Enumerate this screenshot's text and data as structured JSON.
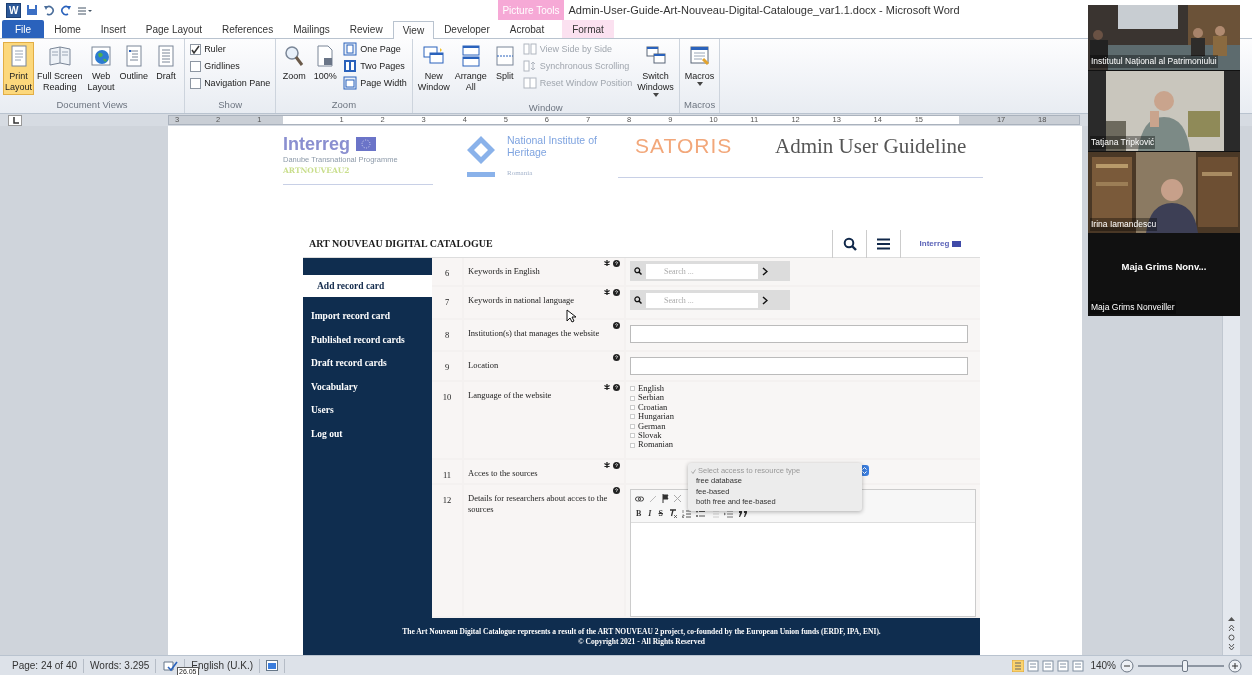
{
  "title_bar": {
    "app_logo": "W",
    "context_group": "Picture Tools",
    "title": "Admin-User-Guide-Art-Nouveau-Digital-Catalouge_var1.1.docx  -  Microsoft Word"
  },
  "ribbon_tabs": [
    {
      "label": "File",
      "kind": "file",
      "selected": false
    },
    {
      "label": "Home",
      "kind": "tab",
      "selected": false
    },
    {
      "label": "Insert",
      "kind": "tab",
      "selected": false
    },
    {
      "label": "Page Layout",
      "kind": "tab",
      "selected": false
    },
    {
      "label": "References",
      "kind": "tab",
      "selected": false
    },
    {
      "label": "Mailings",
      "kind": "tab",
      "selected": false
    },
    {
      "label": "Review",
      "kind": "tab",
      "selected": false
    },
    {
      "label": "View",
      "kind": "tab",
      "selected": true
    },
    {
      "label": "Developer",
      "kind": "tab",
      "selected": false
    },
    {
      "label": "Acrobat",
      "kind": "tab",
      "selected": false
    },
    {
      "label": "Format",
      "kind": "contextual",
      "selected": false
    }
  ],
  "ribbon_groups": [
    {
      "label": "Document Views",
      "items": [
        {
          "kind": "large",
          "label": "Print\nLayout",
          "selected": true
        },
        {
          "kind": "large",
          "label": "Full Screen\nReading",
          "selected": false
        },
        {
          "kind": "large",
          "label": "Web\nLayout",
          "selected": false
        },
        {
          "kind": "large",
          "label": "Outline",
          "selected": false
        },
        {
          "kind": "large",
          "label": "Draft",
          "selected": false
        }
      ]
    },
    {
      "label": "Show",
      "items": [
        {
          "kind": "check",
          "label": "Ruler",
          "checked": true
        },
        {
          "kind": "check",
          "label": "Gridlines",
          "checked": false
        },
        {
          "kind": "check",
          "label": "Navigation Pane",
          "checked": false
        }
      ]
    },
    {
      "label": "Zoom",
      "items": [
        {
          "kind": "large",
          "label": "Zoom",
          "selected": false
        },
        {
          "kind": "large",
          "label": "100%",
          "selected": false
        },
        {
          "kind": "small",
          "label": "One Page",
          "disabled": false
        },
        {
          "kind": "small",
          "label": "Two Pages",
          "disabled": false
        },
        {
          "kind": "small",
          "label": "Page Width",
          "disabled": false
        }
      ]
    },
    {
      "label": "Window",
      "items": [
        {
          "kind": "large",
          "label": "New\nWindow",
          "selected": false
        },
        {
          "kind": "large",
          "label": "Arrange\nAll",
          "selected": false
        },
        {
          "kind": "large",
          "label": "Split",
          "selected": false
        },
        {
          "kind": "small",
          "label": "View Side by Side",
          "disabled": true
        },
        {
          "kind": "small",
          "label": "Synchronous Scrolling",
          "disabled": true
        },
        {
          "kind": "small",
          "label": "Reset Window Position",
          "disabled": true
        },
        {
          "kind": "large",
          "label": "Switch\nWindows",
          "selected": false,
          "dropdown": true
        }
      ]
    },
    {
      "label": "Macros",
      "items": [
        {
          "kind": "large",
          "label": "Macros",
          "selected": false,
          "dropdown": true
        }
      ]
    }
  ],
  "ruler": {
    "labels": [
      "3",
      "2",
      "1",
      "1",
      "2",
      "3",
      "4",
      "5",
      "6",
      "7",
      "8",
      "9",
      "10",
      "11",
      "12",
      "13",
      "14",
      "15",
      "17",
      "18"
    ]
  },
  "document": {
    "partner_logo": {
      "name": "Interreg",
      "subtitle": "Danube Transnational Programme",
      "project": "ARTNOUVEAU2"
    },
    "institute": {
      "name": "National Institute of\nHeritage",
      "country": "Romania"
    },
    "brand": "SATORIS",
    "heading": "Admin User Guideline",
    "catalogue": {
      "title": "ART NOUVEAU DIGITAL CATALOGUE",
      "corner_logo": "Interreg",
      "menu": [
        {
          "label": "Add record card",
          "selected": true
        },
        {
          "label": "Import record card",
          "selected": false
        },
        {
          "label": "Published record cards",
          "selected": false
        },
        {
          "label": "Draft record cards",
          "selected": false
        },
        {
          "label": "Vocabulary",
          "selected": false
        },
        {
          "label": "Users",
          "selected": false
        },
        {
          "label": "Log out",
          "selected": false
        }
      ],
      "fields": [
        {
          "number": "6",
          "label": "Keywords in English",
          "required": true,
          "kind": "search",
          "placeholder": "Search ..."
        },
        {
          "number": "7",
          "label": "Keywords in national language",
          "required": true,
          "kind": "search",
          "placeholder": "Search ..."
        },
        {
          "number": "8",
          "label": "Institution(s) that manages the website",
          "required": false,
          "kind": "text"
        },
        {
          "number": "9",
          "label": "Location",
          "required": false,
          "kind": "text"
        },
        {
          "number": "10",
          "label": "Language of the website",
          "required": true,
          "kind": "checklist",
          "options": [
            {
              "label": "English",
              "checked": false
            },
            {
              "label": "Serbian",
              "checked": false
            },
            {
              "label": "Croatian",
              "checked": false
            },
            {
              "label": "Hungarian",
              "checked": false
            },
            {
              "label": "German",
              "checked": false
            },
            {
              "label": "Slovak",
              "checked": false
            },
            {
              "label": "Romanian",
              "checked": false
            }
          ]
        },
        {
          "number": "11",
          "label": "Acces to the sources",
          "required": true,
          "kind": "select",
          "options": [
            {
              "label": "Select access to resource type",
              "selected": true
            },
            {
              "label": "free database",
              "selected": false
            },
            {
              "label": "fee-based",
              "selected": false
            },
            {
              "label": "both free and fee-based",
              "selected": false
            }
          ]
        },
        {
          "number": "12",
          "label": "Details for researchers about acces to the sources",
          "required": false,
          "kind": "editor",
          "format_buttons": [
            "B",
            "I",
            "S"
          ]
        }
      ],
      "footer": [
        "The Art Nouveau Digital Catalogue represents a result of the ART NOUVEAU 2 project, co-founded by the European Union funds (ERDF, IPA, ENI).",
        "© Copyright 2021 - All Rights Reserved"
      ]
    }
  },
  "status_bar": {
    "page": "Page: 24 of 40",
    "words": "Words: 3.295",
    "language": "English (U.K.)",
    "tooltip": "26.05",
    "zoom": "140%",
    "zoom_slider": {
      "level": 0.55
    }
  },
  "participants": [
    {
      "name": "Institutul Național al Patrimoniului",
      "kind": "video"
    },
    {
      "name": "Tatjana Tripković",
      "kind": "video"
    },
    {
      "name": "Irina Iamandescu",
      "kind": "video"
    },
    {
      "name": "Maja Grims Nonveiller",
      "kind": "camera_off",
      "display_name": "Maja Grims Nonv..."
    }
  ]
}
